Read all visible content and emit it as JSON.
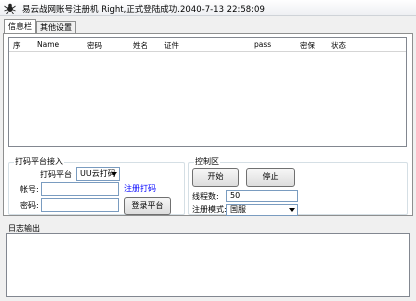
{
  "titlebar": {
    "title": "易云战网账号注册机    Right,正式登陆成功.2040-7-13 22:58:09",
    "icon": "spider-icon"
  },
  "tabs": [
    {
      "label": "信息栏",
      "active": true
    },
    {
      "label": "其他设置",
      "active": false
    }
  ],
  "grid": {
    "columns": [
      "序",
      "Name",
      "密码",
      "姓名",
      "证件",
      "pass",
      "密保",
      "状态"
    ],
    "rows": []
  },
  "captcha_group": {
    "title": "打码平台接入",
    "platform_label": "打码平台",
    "platform_value": "UU云打码",
    "register_link": "注册打码",
    "account_label": "帐号:",
    "account_value": "",
    "password_label": "密码:",
    "password_value": "",
    "login_button": "登录平台"
  },
  "control_group": {
    "title": "控制区",
    "start_button": "开始",
    "stop_button": "停止",
    "threads_label": "线程数:",
    "threads_value": "50",
    "mode_label": "注册模式:",
    "mode_value": "国服"
  },
  "log": {
    "label": "日志输出",
    "content": ""
  },
  "colors": {
    "link": "#0000ff",
    "input_border": "#7a9cc0",
    "panel_bg": "#ffffff",
    "window_bg": "#f0f0f0"
  }
}
